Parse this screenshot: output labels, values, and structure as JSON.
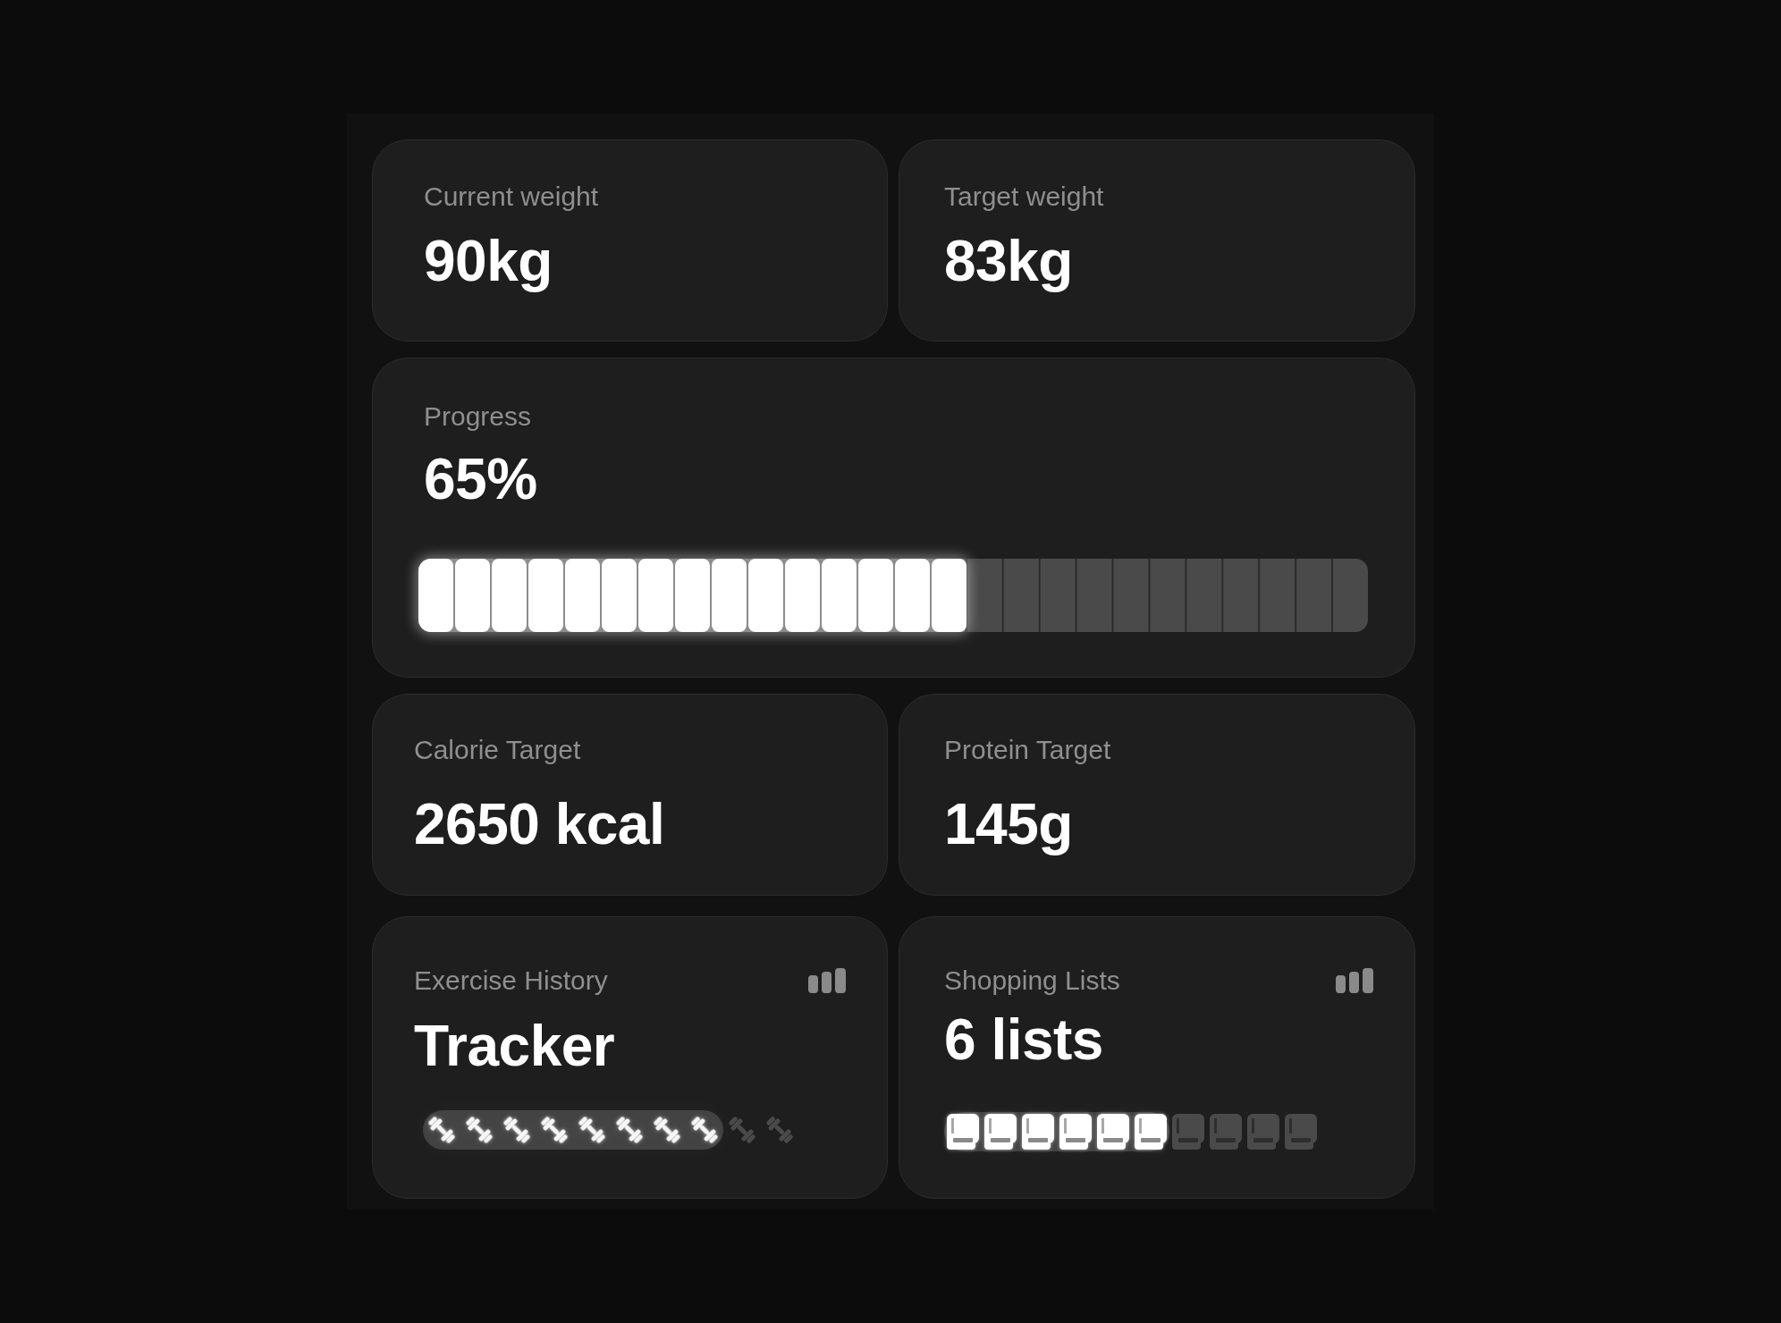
{
  "current_weight": {
    "label": "Current weight",
    "value": "90kg"
  },
  "target_weight": {
    "label": "Target weight",
    "value": "83kg"
  },
  "progress": {
    "label": "Progress",
    "value": "65%",
    "level": 0.577
  },
  "calorie_target": {
    "label": "Calorie Target",
    "value": "2650 kcal"
  },
  "protein_target": {
    "label": "Protein Target",
    "value": "145g"
  },
  "exercise_history": {
    "label": "Exercise History",
    "value": "Tracker",
    "level": 0.8
  },
  "shopping_lists": {
    "label": "Shopping Lists",
    "value": "6 lists",
    "level": 0.6
  }
}
